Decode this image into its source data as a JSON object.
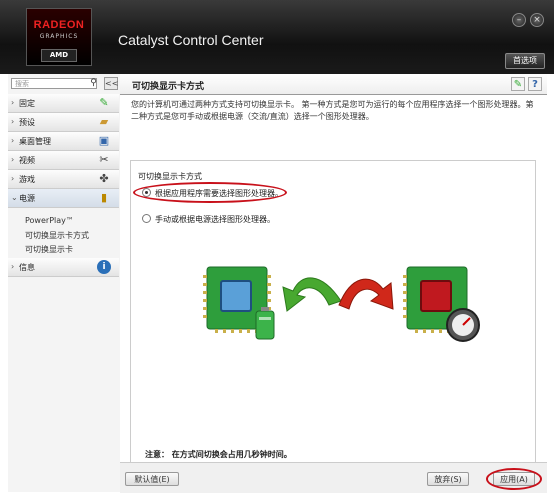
{
  "app": {
    "title": "Catalyst Control Center",
    "logo": {
      "line1": "RADEON",
      "line2": "GRAPHICS",
      "line3": "AMD"
    },
    "preferences_label": "首选项",
    "window_buttons": [
      "–",
      "×"
    ]
  },
  "sidebar": {
    "search_placeholder": "搜索",
    "collapse_label": "<<",
    "items": [
      {
        "label": "固定",
        "icon": "pin-icon"
      },
      {
        "label": "预设",
        "icon": "preset-icon"
      },
      {
        "label": "桌面管理",
        "icon": "desktop-icon"
      },
      {
        "label": "视频",
        "icon": "video-icon"
      },
      {
        "label": "游戏",
        "icon": "gamepad-icon"
      },
      {
        "label": "电源",
        "icon": "battery-icon"
      },
      {
        "label": "信息",
        "icon": "info-icon"
      }
    ],
    "power_subitems": [
      "PowerPlay™",
      "可切换显示卡方式",
      "可切换显示卡"
    ]
  },
  "main": {
    "title": "可切换显示卡方式",
    "description": "您的计算机可通过两种方式支持可切换显示卡。 第一种方式是您可为运行的每个应用程序选择一个图形处理器。第二种方式是您可手动或根据电源（交流/直流）选择一个图形处理器。",
    "panel": {
      "title": "可切换显示卡方式",
      "option1": "根据应用程序需要选择图形处理器。",
      "option2": "手动或根据电源选择图形处理器。",
      "selected": "option1",
      "note": "注意： 在方式间切换会占用几秒钟时间。"
    }
  },
  "footer": {
    "defaults_label": "默认值(E)",
    "discard_label": "放弃(S)",
    "apply_label": "应用(A)"
  },
  "colors": {
    "highlight": "#c8101a",
    "chip_green": "#2e9e3c",
    "arrow_green": "#48a830",
    "arrow_red": "#d0281a"
  }
}
